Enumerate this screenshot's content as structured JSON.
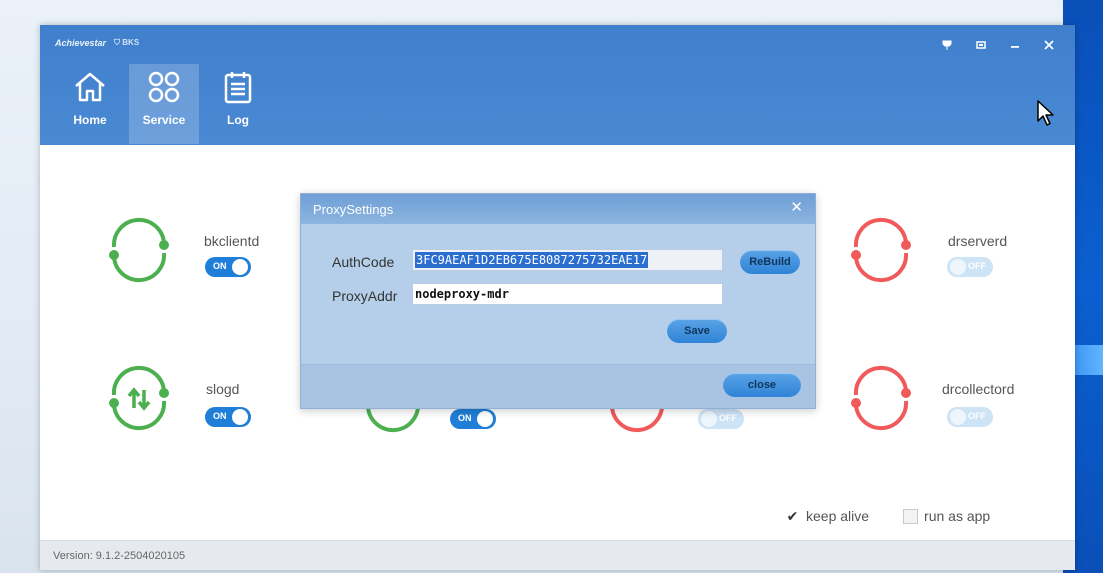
{
  "app": {
    "brand": "Achievestar",
    "brand_badge": "BKS"
  },
  "nav": {
    "tabs": [
      {
        "label": "Home",
        "icon": "home-icon",
        "active": false
      },
      {
        "label": "Service",
        "icon": "service-icon",
        "active": true
      },
      {
        "label": "Log",
        "icon": "log-icon",
        "active": false
      }
    ]
  },
  "services": [
    {
      "name": "bkclientd",
      "state": "ON",
      "color": "#4caf50"
    },
    {
      "name": "drserverd",
      "state": "OFF",
      "color": "#f05a5a"
    },
    {
      "name": "slogd",
      "state": "ON",
      "color": "#4caf50"
    },
    {
      "name": "",
      "state": "ON",
      "color": "#4caf50"
    },
    {
      "name": "",
      "state": "OFF",
      "color": "#f05a5a"
    },
    {
      "name": "drcollectord",
      "state": "OFF",
      "color": "#f05a5a"
    }
  ],
  "options": {
    "keep_alive": {
      "label": "keep alive",
      "checked": true
    },
    "run_as_app": {
      "label": "run as app",
      "checked": false
    }
  },
  "status": {
    "version": "Version: 9.1.2-2504020105"
  },
  "dialog": {
    "title": "ProxySettings",
    "authcode_label": "AuthCode",
    "authcode_value": "3FC9AEAF1D2EB675E8087275732EAE17",
    "proxyaddr_label": "ProxyAddr",
    "proxyaddr_value": "nodeproxy-mdr",
    "rebuild_label": "ReBuild",
    "save_label": "Save",
    "close_label": "close"
  },
  "colors": {
    "titlebar": "#4a89d2",
    "toggle_on": "#1f7fd8",
    "ring_green": "#4caf50",
    "ring_red": "#f05a5a"
  }
}
